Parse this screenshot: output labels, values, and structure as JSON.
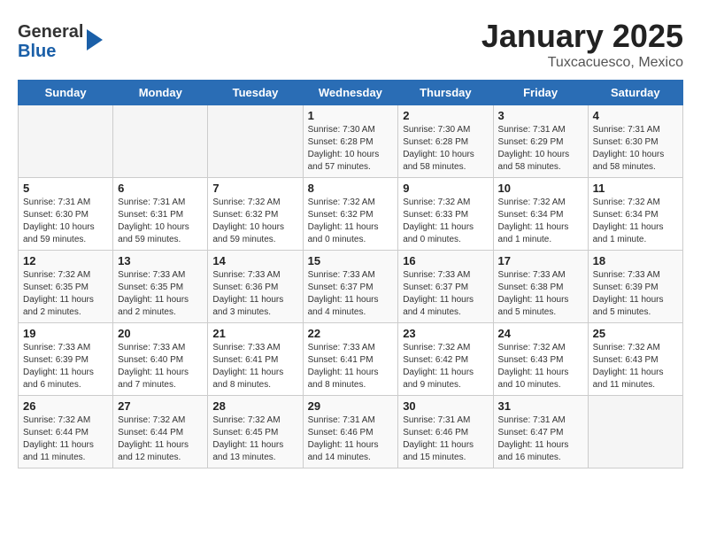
{
  "header": {
    "logo_general": "General",
    "logo_blue": "Blue",
    "main_title": "January 2025",
    "sub_title": "Tuxcacuesco, Mexico"
  },
  "days_of_week": [
    "Sunday",
    "Monday",
    "Tuesday",
    "Wednesday",
    "Thursday",
    "Friday",
    "Saturday"
  ],
  "weeks": [
    [
      {
        "day": "",
        "info": ""
      },
      {
        "day": "",
        "info": ""
      },
      {
        "day": "",
        "info": ""
      },
      {
        "day": "1",
        "info": "Sunrise: 7:30 AM\nSunset: 6:28 PM\nDaylight: 10 hours\nand 57 minutes."
      },
      {
        "day": "2",
        "info": "Sunrise: 7:30 AM\nSunset: 6:28 PM\nDaylight: 10 hours\nand 58 minutes."
      },
      {
        "day": "3",
        "info": "Sunrise: 7:31 AM\nSunset: 6:29 PM\nDaylight: 10 hours\nand 58 minutes."
      },
      {
        "day": "4",
        "info": "Sunrise: 7:31 AM\nSunset: 6:30 PM\nDaylight: 10 hours\nand 58 minutes."
      }
    ],
    [
      {
        "day": "5",
        "info": "Sunrise: 7:31 AM\nSunset: 6:30 PM\nDaylight: 10 hours\nand 59 minutes."
      },
      {
        "day": "6",
        "info": "Sunrise: 7:31 AM\nSunset: 6:31 PM\nDaylight: 10 hours\nand 59 minutes."
      },
      {
        "day": "7",
        "info": "Sunrise: 7:32 AM\nSunset: 6:32 PM\nDaylight: 10 hours\nand 59 minutes."
      },
      {
        "day": "8",
        "info": "Sunrise: 7:32 AM\nSunset: 6:32 PM\nDaylight: 11 hours\nand 0 minutes."
      },
      {
        "day": "9",
        "info": "Sunrise: 7:32 AM\nSunset: 6:33 PM\nDaylight: 11 hours\nand 0 minutes."
      },
      {
        "day": "10",
        "info": "Sunrise: 7:32 AM\nSunset: 6:34 PM\nDaylight: 11 hours\nand 1 minute."
      },
      {
        "day": "11",
        "info": "Sunrise: 7:32 AM\nSunset: 6:34 PM\nDaylight: 11 hours\nand 1 minute."
      }
    ],
    [
      {
        "day": "12",
        "info": "Sunrise: 7:32 AM\nSunset: 6:35 PM\nDaylight: 11 hours\nand 2 minutes."
      },
      {
        "day": "13",
        "info": "Sunrise: 7:33 AM\nSunset: 6:35 PM\nDaylight: 11 hours\nand 2 minutes."
      },
      {
        "day": "14",
        "info": "Sunrise: 7:33 AM\nSunset: 6:36 PM\nDaylight: 11 hours\nand 3 minutes."
      },
      {
        "day": "15",
        "info": "Sunrise: 7:33 AM\nSunset: 6:37 PM\nDaylight: 11 hours\nand 4 minutes."
      },
      {
        "day": "16",
        "info": "Sunrise: 7:33 AM\nSunset: 6:37 PM\nDaylight: 11 hours\nand 4 minutes."
      },
      {
        "day": "17",
        "info": "Sunrise: 7:33 AM\nSunset: 6:38 PM\nDaylight: 11 hours\nand 5 minutes."
      },
      {
        "day": "18",
        "info": "Sunrise: 7:33 AM\nSunset: 6:39 PM\nDaylight: 11 hours\nand 5 minutes."
      }
    ],
    [
      {
        "day": "19",
        "info": "Sunrise: 7:33 AM\nSunset: 6:39 PM\nDaylight: 11 hours\nand 6 minutes."
      },
      {
        "day": "20",
        "info": "Sunrise: 7:33 AM\nSunset: 6:40 PM\nDaylight: 11 hours\nand 7 minutes."
      },
      {
        "day": "21",
        "info": "Sunrise: 7:33 AM\nSunset: 6:41 PM\nDaylight: 11 hours\nand 8 minutes."
      },
      {
        "day": "22",
        "info": "Sunrise: 7:33 AM\nSunset: 6:41 PM\nDaylight: 11 hours\nand 8 minutes."
      },
      {
        "day": "23",
        "info": "Sunrise: 7:32 AM\nSunset: 6:42 PM\nDaylight: 11 hours\nand 9 minutes."
      },
      {
        "day": "24",
        "info": "Sunrise: 7:32 AM\nSunset: 6:43 PM\nDaylight: 11 hours\nand 10 minutes."
      },
      {
        "day": "25",
        "info": "Sunrise: 7:32 AM\nSunset: 6:43 PM\nDaylight: 11 hours\nand 11 minutes."
      }
    ],
    [
      {
        "day": "26",
        "info": "Sunrise: 7:32 AM\nSunset: 6:44 PM\nDaylight: 11 hours\nand 11 minutes."
      },
      {
        "day": "27",
        "info": "Sunrise: 7:32 AM\nSunset: 6:44 PM\nDaylight: 11 hours\nand 12 minutes."
      },
      {
        "day": "28",
        "info": "Sunrise: 7:32 AM\nSunset: 6:45 PM\nDaylight: 11 hours\nand 13 minutes."
      },
      {
        "day": "29",
        "info": "Sunrise: 7:31 AM\nSunset: 6:46 PM\nDaylight: 11 hours\nand 14 minutes."
      },
      {
        "day": "30",
        "info": "Sunrise: 7:31 AM\nSunset: 6:46 PM\nDaylight: 11 hours\nand 15 minutes."
      },
      {
        "day": "31",
        "info": "Sunrise: 7:31 AM\nSunset: 6:47 PM\nDaylight: 11 hours\nand 16 minutes."
      },
      {
        "day": "",
        "info": ""
      }
    ]
  ]
}
